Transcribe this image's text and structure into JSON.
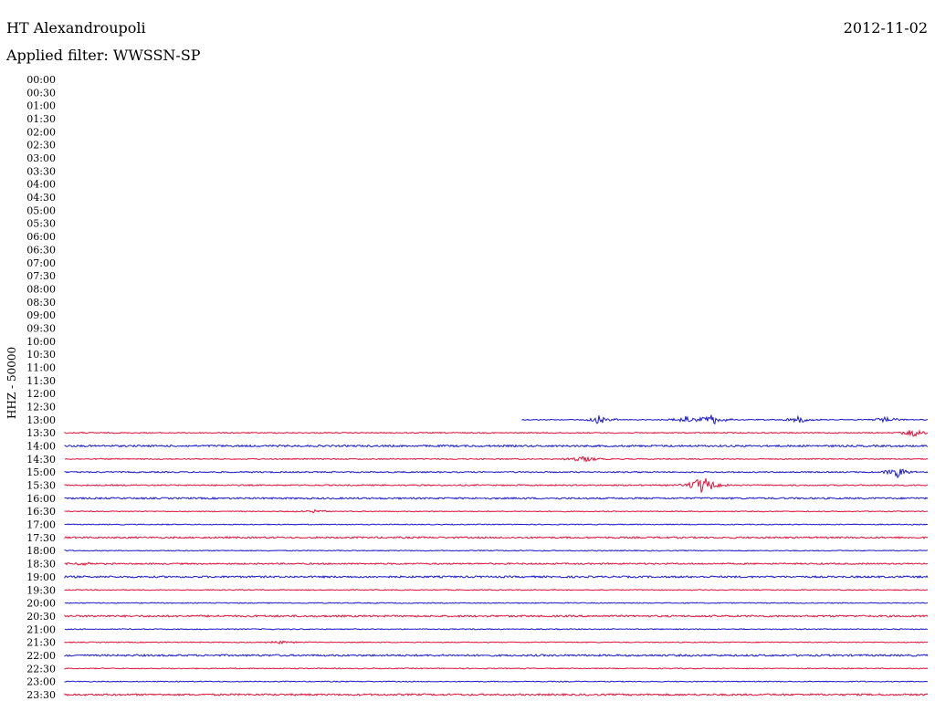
{
  "header": {
    "station": "HT Alexandroupoli",
    "filter": "Applied filter: WWSSN-SP",
    "date": "2012-11-02"
  },
  "chart_data": {
    "type": "line",
    "title": "HT Alexandroupoli",
    "subtitle": "Applied filter: WWSSN-SP",
    "ylabel": "HHZ - 50000",
    "colors": {
      "odd": "#1a1acc",
      "even": "#e0143c"
    },
    "time_labels": [
      "00:00",
      "00:30",
      "01:00",
      "01:30",
      "02:00",
      "02:30",
      "03:00",
      "03:30",
      "04:00",
      "04:30",
      "05:00",
      "05:30",
      "06:00",
      "06:30",
      "07:00",
      "07:30",
      "08:00",
      "08:30",
      "09:00",
      "09:30",
      "10:00",
      "10:30",
      "11:00",
      "11:30",
      "12:00",
      "12:30",
      "13:00",
      "13:30",
      "14:00",
      "14:30",
      "15:00",
      "15:30",
      "16:00",
      "16:30",
      "17:00",
      "17:30",
      "18:00",
      "18:30",
      "19:00",
      "19:30",
      "20:00",
      "20:30",
      "21:00",
      "21:30",
      "22:00",
      "22:30",
      "23:00",
      "23:30"
    ],
    "traces": [
      {
        "label": "13:00",
        "start_frac": 0.53,
        "noise": 0.5,
        "color": "blue",
        "events": [
          {
            "at": 0.06,
            "amp": 5
          },
          {
            "at": 0.09,
            "amp": 4
          },
          {
            "at": 0.22,
            "amp": 4
          },
          {
            "at": 0.3,
            "amp": 5
          },
          {
            "at": 0.4,
            "amp": 6
          },
          {
            "at": 0.47,
            "amp": 6
          },
          {
            "at": 0.62,
            "amp": 5
          },
          {
            "at": 0.72,
            "amp": 4
          },
          {
            "at": 0.75,
            "amp": 6
          },
          {
            "at": 0.85,
            "amp": 4
          },
          {
            "at": 0.95,
            "amp": 3
          }
        ]
      },
      {
        "label": "13:30",
        "start_frac": 0,
        "noise": 0.6,
        "color": "red",
        "events": [
          {
            "at": 0.985,
            "amp": 5
          }
        ]
      },
      {
        "label": "14:00",
        "start_frac": 0,
        "noise": 1.0,
        "color": "blue",
        "events": []
      },
      {
        "label": "14:30",
        "start_frac": 0,
        "noise": 0.6,
        "color": "red",
        "events": [
          {
            "at": 0.6,
            "amp": 4
          }
        ]
      },
      {
        "label": "15:00",
        "start_frac": 0,
        "noise": 0.7,
        "color": "blue",
        "events": [
          {
            "at": 0.965,
            "amp": 6
          }
        ]
      },
      {
        "label": "15:30",
        "start_frac": 0,
        "noise": 0.7,
        "color": "red",
        "events": [
          {
            "at": 0.74,
            "amp": 12
          }
        ]
      },
      {
        "label": "16:00",
        "start_frac": 0,
        "noise": 0.9,
        "color": "blue",
        "events": []
      },
      {
        "label": "16:30",
        "start_frac": 0,
        "noise": 0.5,
        "color": "red",
        "events": [
          {
            "at": 0.29,
            "amp": 2
          }
        ]
      },
      {
        "label": "17:00",
        "start_frac": 0,
        "noise": 0.5,
        "color": "blue",
        "events": []
      },
      {
        "label": "17:30",
        "start_frac": 0,
        "noise": 0.9,
        "color": "red",
        "events": []
      },
      {
        "label": "18:00",
        "start_frac": 0,
        "noise": 0.5,
        "color": "blue",
        "events": []
      },
      {
        "label": "18:30",
        "start_frac": 0,
        "noise": 0.8,
        "color": "red",
        "events": [
          {
            "at": 0.02,
            "amp": 2
          }
        ]
      },
      {
        "label": "19:00",
        "start_frac": 0,
        "noise": 1.0,
        "color": "blue",
        "events": []
      },
      {
        "label": "19:30",
        "start_frac": 0,
        "noise": 0.5,
        "color": "red",
        "events": []
      },
      {
        "label": "20:00",
        "start_frac": 0,
        "noise": 0.5,
        "color": "blue",
        "events": []
      },
      {
        "label": "20:30",
        "start_frac": 0,
        "noise": 1.0,
        "color": "red",
        "events": []
      },
      {
        "label": "21:00",
        "start_frac": 0,
        "noise": 0.5,
        "color": "blue",
        "events": []
      },
      {
        "label": "21:30",
        "start_frac": 0,
        "noise": 0.5,
        "color": "red",
        "events": [
          {
            "at": 0.25,
            "amp": 2
          }
        ]
      },
      {
        "label": "22:00",
        "start_frac": 0,
        "noise": 1.0,
        "color": "blue",
        "events": []
      },
      {
        "label": "22:30",
        "start_frac": 0,
        "noise": 0.5,
        "color": "red",
        "events": []
      },
      {
        "label": "23:00",
        "start_frac": 0,
        "noise": 0.5,
        "color": "blue",
        "events": []
      },
      {
        "label": "23:30",
        "start_frac": 0,
        "noise": 1.0,
        "color": "red",
        "events": []
      }
    ]
  }
}
